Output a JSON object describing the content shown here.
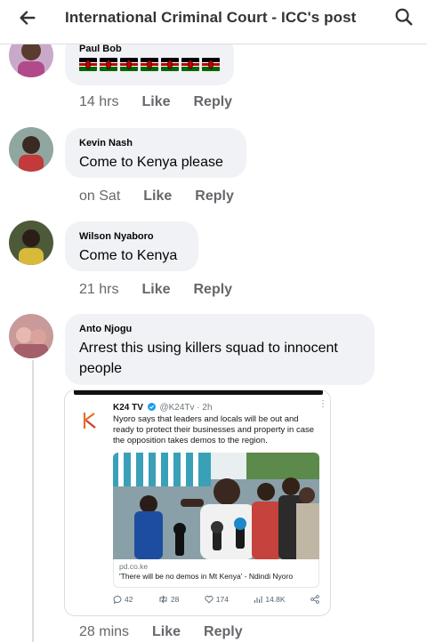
{
  "header": {
    "title": "International Criminal Court - ICC's post",
    "back_icon": "arrow-left-icon",
    "search_icon": "search-icon"
  },
  "comments": [
    {
      "author": "Paul Bob",
      "text": "🇰🇪🇰🇪🇰🇪🇰🇪🇰🇪🇰🇪🇰🇪",
      "time": "14 hrs",
      "like": "Like",
      "reply": "Reply"
    },
    {
      "author": "Kevin Nash",
      "text": "Come to Kenya please",
      "time": "on Sat",
      "like": "Like",
      "reply": "Reply"
    },
    {
      "author": "Wilson Nyaboro",
      "text": "Come to Kenya",
      "time": "21 hrs",
      "like": "Like",
      "reply": "Reply"
    },
    {
      "author": "Anto Njogu",
      "text": "Arrest this using killers squad to innocent people",
      "time": "28 mins",
      "like": "Like",
      "reply": "Reply"
    }
  ],
  "embed": {
    "tweet_name": "K24 TV",
    "tweet_handle": "@K24Tv · 2h",
    "tweet_text": "Nyoro says that leaders and locals will be out and ready to protect their businesses and property in case the opposition takes demos to the region.",
    "link_domain": "pd.co.ke",
    "link_headline": "'There will be no demos in Mt Kenya' - Ndindi Nyoro",
    "replies": "42",
    "retweets": "28",
    "likes": "174",
    "views": "14.8K"
  },
  "colors": {
    "bubble": "#f0f2f5",
    "meta": "#65676b",
    "kenya_black": "#000000",
    "kenya_red": "#bb0000",
    "kenya_green": "#006600"
  }
}
